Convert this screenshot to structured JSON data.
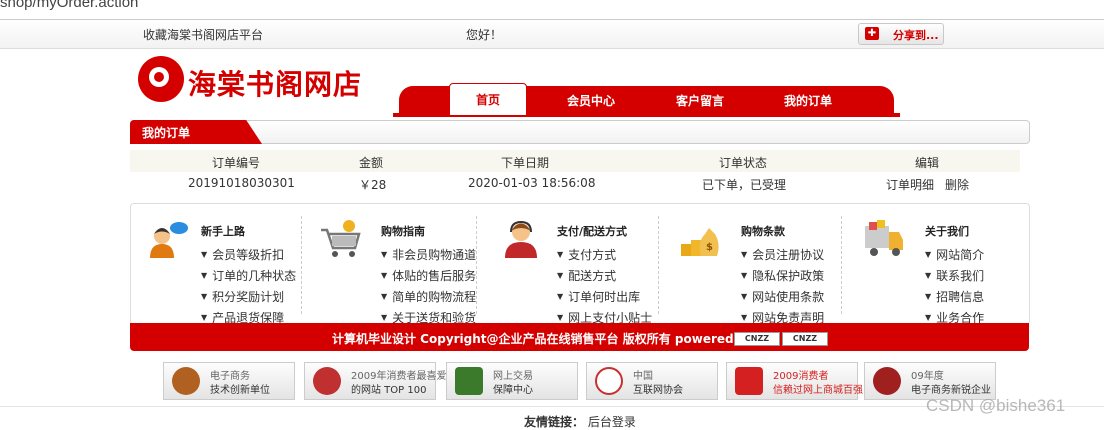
{
  "address_bar": {
    "url": "shop/myOrder.action"
  },
  "topbar": {
    "favorite": "收藏海棠书阁网店平台",
    "greeting": "您好！",
    "share_label": "分享到..."
  },
  "logo": {
    "text": "海棠书阁网店"
  },
  "nav": {
    "items": [
      "首页",
      "会员中心",
      "客户留言",
      "我的订单"
    ],
    "active": "首页"
  },
  "section_title": "我的订单",
  "orders": {
    "columns": [
      "订单编号",
      "金额",
      "下单日期",
      "订单状态",
      "编辑"
    ],
    "rows": [
      {
        "id": "20191018030301",
        "amount": "￥28",
        "date": "2020-01-03 18:56:08",
        "status": "已下单，已受理",
        "detail": "订单明细",
        "delete": "删除"
      }
    ]
  },
  "help": [
    {
      "title": "新手上路",
      "icon": "customer-service-icon",
      "items": [
        "会员等级折扣",
        "订单的几种状态",
        "积分奖励计划",
        "产品退货保障"
      ]
    },
    {
      "title": "购物指南",
      "icon": "shopping-cart-icon",
      "items": [
        "非会员购物通道",
        "体贴的售后服务",
        "简单的购物流程",
        "关于送货和验货"
      ]
    },
    {
      "title": "支付/配送方式",
      "icon": "headset-agent-icon",
      "items": [
        "支付方式",
        "配送方式",
        "订单何时出库",
        "网上支付小贴士"
      ]
    },
    {
      "title": "购物条款",
      "icon": "money-bag-icon",
      "items": [
        "会员注册协议",
        "隐私保护政策",
        "网站使用条款",
        "网站免责声明"
      ]
    },
    {
      "title": "关于我们",
      "icon": "delivery-truck-icon",
      "items": [
        "网站简介",
        "联系我们",
        "招聘信息",
        "业务合作"
      ]
    }
  ],
  "footer": {
    "copyright": "计算机毕业设计 Copyright@企业产品在线销售平台 版权所有 powered by",
    "badges": [
      "CNZZ",
      "CNZZ"
    ]
  },
  "certs": [
    {
      "line1": "电子商务",
      "line2": "技术创新单位",
      "color": "#b06020"
    },
    {
      "line1": "2009年消费者最喜爱",
      "line2": "的网站 TOP 100",
      "color": "#c03030"
    },
    {
      "line1": "网上交易",
      "line2": "保障中心",
      "color": "#3a7a2a"
    },
    {
      "line1": "中国",
      "line2": "互联网协会",
      "color": "#c83030"
    },
    {
      "line1": "2009消费者",
      "line2": "信赖过网上商城百强",
      "color": "#d42020"
    },
    {
      "line1": "09年度",
      "line2": "电子商务新锐企业",
      "color": "#a02020"
    }
  ],
  "links": {
    "label": "友情链接：",
    "items": [
      "后台登录"
    ]
  },
  "watermark": "CSDN @bishe361"
}
